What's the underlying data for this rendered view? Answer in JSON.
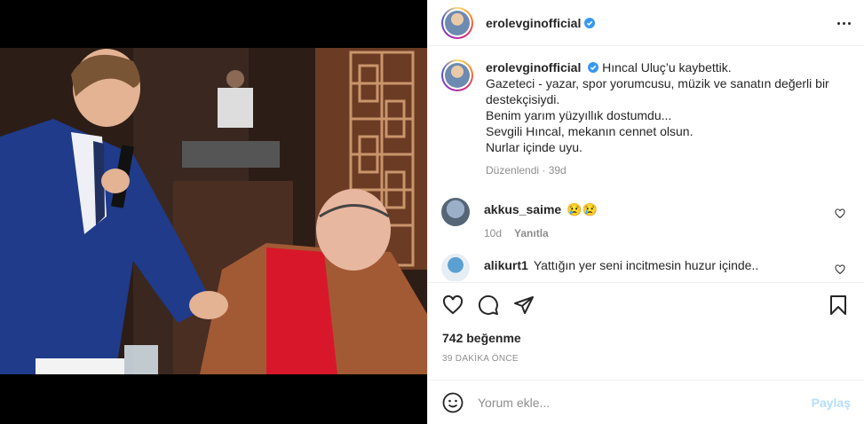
{
  "post": {
    "username": "erolevginofficial",
    "verified": true,
    "caption_lines": [
      "Hıncal Uluç’u kaybettik.",
      "Gazeteci - yazar, spor yorumcusu, müzik ve sanatın değerli bir destekçisiydi.",
      "Benim yarım yüzyıllık dostumdu...",
      "Sevgili Hıncal, mekanın cennet olsun.",
      "Nurlar içinde uyu."
    ],
    "caption_meta": "Düzenlendi · 39d",
    "likes": "742 beğenme",
    "posted": "39 DAKİKA ÖNCE"
  },
  "comments": [
    {
      "username": "akkus_saime",
      "text": "😢😢",
      "age": "10d",
      "reply_label": "Yanıtla"
    },
    {
      "username": "alikurt1",
      "text": "Yattığın yer seni incitmesin huzur içinde..",
      "age": "",
      "reply_label": ""
    }
  ],
  "composer": {
    "placeholder": "Yorum ekle...",
    "post_label": "Paylaş"
  },
  "icons": [
    "more-icon",
    "verified-icon",
    "heart-icon",
    "comment-icon",
    "share-icon",
    "save-icon",
    "emoji-icon"
  ],
  "colors": {
    "link_disabled": "#b2dffc",
    "muted": "#8e8e8e",
    "verified": "#3897f0"
  }
}
